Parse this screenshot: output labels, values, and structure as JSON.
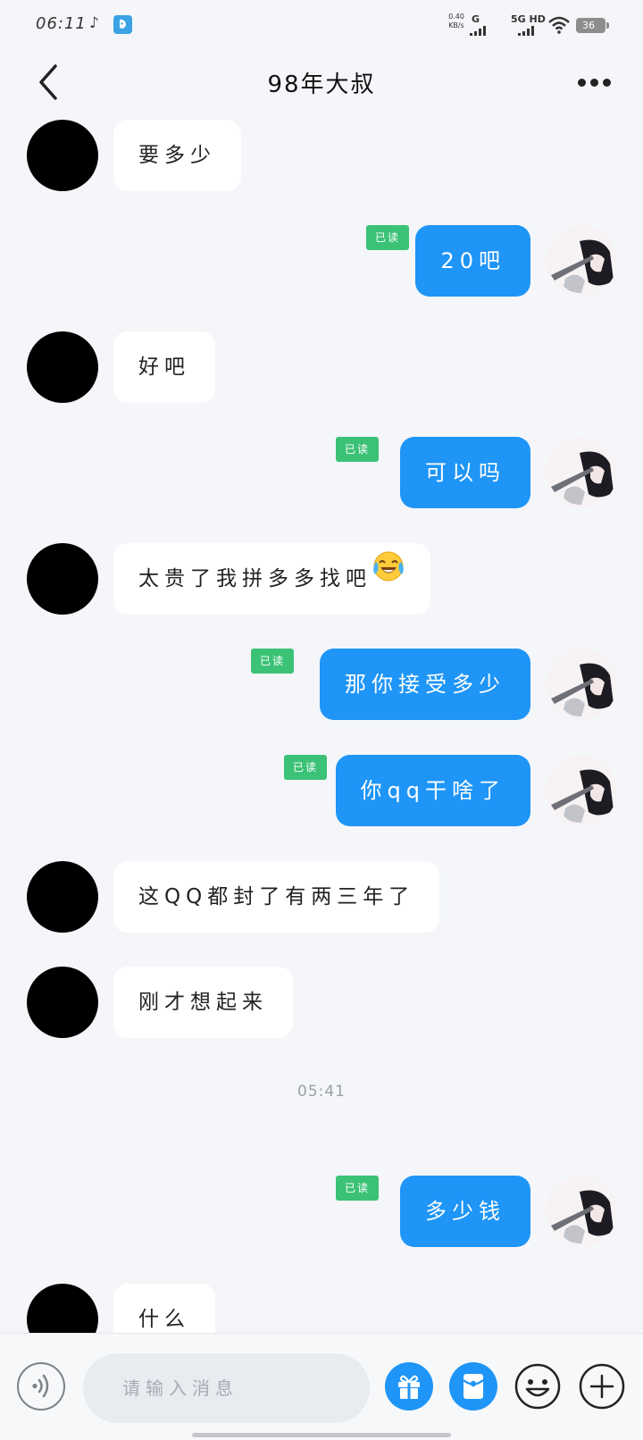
{
  "status_bar": {
    "time": "06:11",
    "speed_value": "0.40",
    "speed_unit": "KB/s",
    "network_1": "G",
    "network_2": "5G HD",
    "battery": "36"
  },
  "header": {
    "title": "98年大叔"
  },
  "messages": [
    {
      "from": "contact",
      "text": "要多少"
    },
    {
      "from": "me",
      "text": "20吧",
      "read": "已读"
    },
    {
      "from": "contact",
      "text": "好吧"
    },
    {
      "from": "me",
      "text": "可以吗",
      "read": "已读"
    },
    {
      "from": "contact",
      "text": "太贵了我拼多多找吧",
      "emoji": "tears-of-joy"
    },
    {
      "from": "me",
      "text": "那你接受多少",
      "read": "已读"
    },
    {
      "from": "me",
      "text": "你qq干啥了",
      "read": "已读"
    },
    {
      "from": "contact",
      "text": "这QQ都封了有两三年了"
    },
    {
      "from": "contact",
      "text": "刚才想起来"
    },
    {
      "timestamp": "05:41"
    },
    {
      "from": "me",
      "text": "多少钱",
      "read": "已读"
    },
    {
      "from": "contact",
      "text": "什么"
    }
  ],
  "input_bar": {
    "placeholder": "请输入消息"
  },
  "colors": {
    "background": "#f4f6f9",
    "outgoing_bubble": "#1e95f7",
    "incoming_bubble": "#ffffff",
    "read_tag": "#3cc277",
    "accent": "#1e95f7"
  },
  "icons": {
    "back": "chevron-left-icon",
    "more": "more-dots-icon",
    "voice": "voice-icon",
    "gift": "gift-icon",
    "red_packet": "red-packet-icon",
    "emoji": "smiley-icon",
    "plus": "plus-icon"
  }
}
